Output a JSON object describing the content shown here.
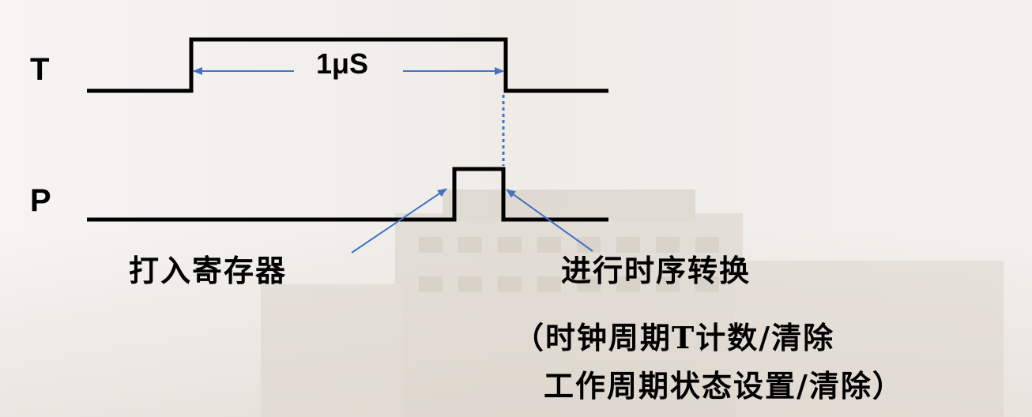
{
  "signals": {
    "t_label": "T",
    "p_label": "P"
  },
  "duration_label": "1μS",
  "annotations": {
    "latch": "打入寄存器",
    "transition": "进行时序转换",
    "detail_line1": "（时钟周期T计数/清除",
    "detail_line2": "工作周期状态设置/清除）"
  },
  "colors": {
    "waveform": "#000000",
    "arrow": "#4472c4",
    "dotted_line": "#4472c4"
  }
}
